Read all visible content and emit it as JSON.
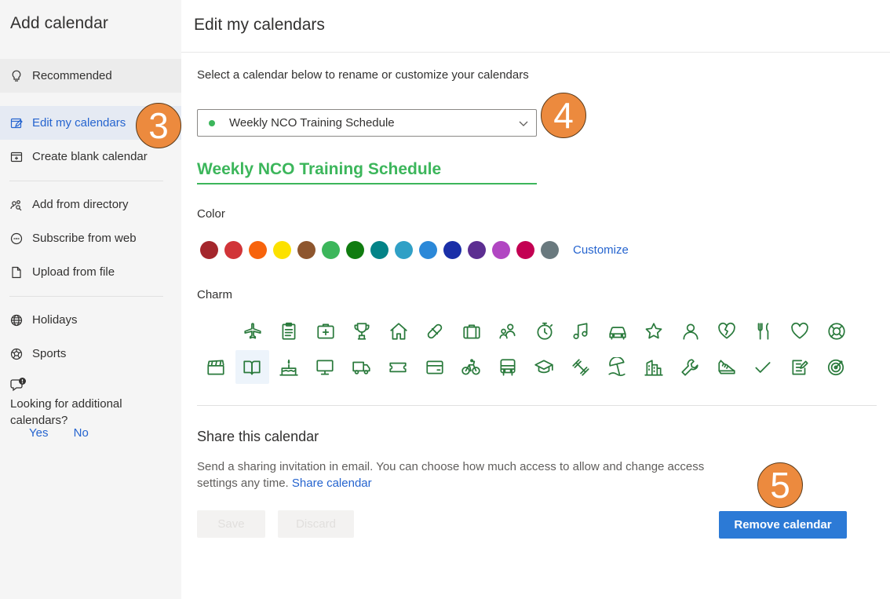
{
  "sidebar": {
    "title": "Add calendar",
    "items": [
      {
        "label": "Recommended",
        "icon": "lightbulb-icon"
      },
      {
        "label": "Edit my calendars",
        "icon": "edit-calendar-icon",
        "selected": true
      },
      {
        "label": "Create blank calendar",
        "icon": "calendar-add-icon"
      },
      {
        "label": "Add from directory",
        "icon": "people-search-icon"
      },
      {
        "label": "Subscribe from web",
        "icon": "link-circle-icon"
      },
      {
        "label": "Upload from file",
        "icon": "document-icon"
      },
      {
        "label": "Holidays",
        "icon": "globe-icon"
      },
      {
        "label": "Sports",
        "icon": "ball-icon"
      }
    ],
    "feedback": {
      "question": "Looking for additional calendars?",
      "yes": "Yes",
      "no": "No",
      "icon": "feedback-chat-icon"
    }
  },
  "main": {
    "title": "Edit my calendars",
    "instruction": "Select a calendar below to rename or customize your calendars",
    "dropdown": {
      "selected": "Weekly NCO Training Schedule",
      "dot_color": "#3cb65b"
    },
    "name_value": "Weekly NCO Training Schedule",
    "color_label": "Color",
    "colors": [
      "#a4262c",
      "#d13438",
      "#f7630c",
      "#fce100",
      "#8e562e",
      "#3cb65b",
      "#107c10",
      "#038387",
      "#30a0c6",
      "#2b88d8",
      "#1a2fa8",
      "#5c2e91",
      "#b146c2",
      "#c30052",
      "#69797e"
    ],
    "customize_label": "Customize",
    "charm_label": "Charm",
    "charms_row1": [
      "airplane-icon",
      "clipboard-icon",
      "first-aid-icon",
      "trophy-icon",
      "home-icon",
      "pill-icon",
      "briefcase-icon",
      "people-icon",
      "stopwatch-icon",
      "music-note-icon",
      "car-icon",
      "star-icon",
      "person-icon",
      "broken-heart-icon",
      "fork-knife-icon",
      "heart-icon",
      "lifebuoy-icon"
    ],
    "charms_row2": [
      "clapperboard-icon",
      "book-icon",
      "cake-icon",
      "monitor-icon",
      "truck-icon",
      "ticket-icon",
      "credit-card-icon",
      "bicycle-icon",
      "bus-icon",
      "graduation-cap-icon",
      "dumbbell-icon",
      "beach-icon",
      "buildings-icon",
      "wrench-icon",
      "shoe-icon",
      "checkmark-icon",
      "notes-icon",
      "target-icon"
    ],
    "selected_charm": "book-icon",
    "share": {
      "title": "Share this calendar",
      "desc": "Send a sharing invitation in email. You can choose how much access to allow and change access settings any time.",
      "link": "Share calendar"
    },
    "buttons": {
      "save": "Save",
      "discard": "Discard",
      "remove": "Remove calendar"
    }
  },
  "callouts": [
    "3",
    "4",
    "5"
  ]
}
